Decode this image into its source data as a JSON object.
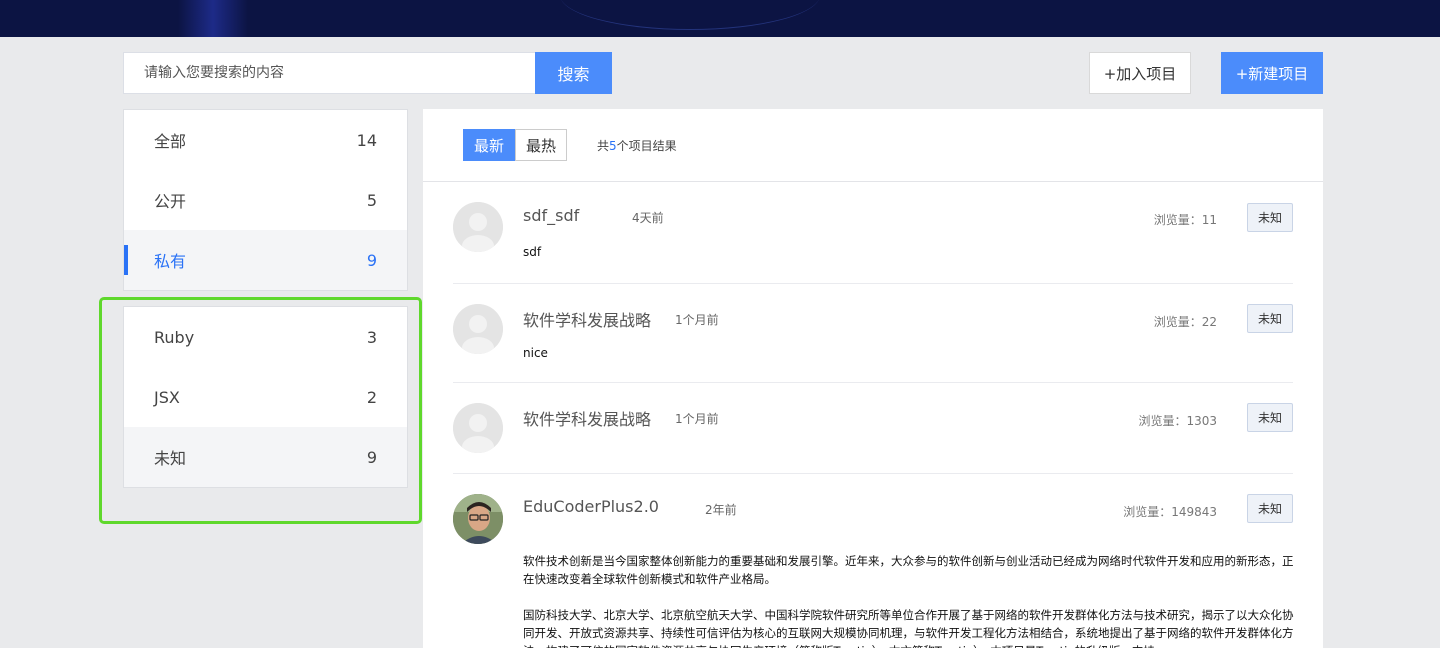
{
  "search": {
    "placeholder": "请输入您要搜索的内容",
    "button_label": "搜索"
  },
  "actions": {
    "join_label": "+加入项目",
    "new_label": "+新建项目"
  },
  "sidebar": {
    "visibility": [
      {
        "label": "全部",
        "count": "14"
      },
      {
        "label": "公开",
        "count": "5"
      },
      {
        "label": "私有",
        "count": "9"
      }
    ],
    "languages": [
      {
        "label": "Ruby",
        "count": "3"
      },
      {
        "label": "JSX",
        "count": "2"
      },
      {
        "label": "未知",
        "count": "9"
      }
    ]
  },
  "main": {
    "tabs": [
      {
        "label": "最新"
      },
      {
        "label": "最热"
      }
    ],
    "result": {
      "prefix": "共",
      "count": "5",
      "suffix": "个项目结果"
    },
    "projects": [
      {
        "title": "sdf_sdf",
        "time": "4天前",
        "views": "浏览量：11",
        "tag": "未知",
        "desc": "sdf"
      },
      {
        "title": "软件学科发展战略",
        "time": "1个月前",
        "views": "浏览量：22",
        "tag": "未知",
        "desc": "nice"
      },
      {
        "title": "软件学科发展战略",
        "time": "1个月前",
        "views": "浏览量：1303",
        "tag": "未知",
        "desc": ""
      },
      {
        "title": "EduCoderPlus2.0",
        "time": "2年前",
        "views": "浏览量：149843",
        "tag": "未知",
        "desc_paragraphs": [
          "软件技术创新是当今国家整体创新能力的重要基础和发展引擎。近年来，大众参与的软件创新与创业活动已经成为网络时代软件开发和应用的新形态，正在快速改变着全球软件创新模式和软件产业格局。",
          "国防科技大学、北京大学、北京航空航天大学、中国科学院软件研究所等单位合作开展了基于网络的软件开发群体化方法与技术研究，揭示了以大众化协同开发、开放式资源共享、持续性可信评估为核心的互联网大规模协同机理，与软件开发工程化方法相结合，系统地提出了基于网络的软件开发群体化方法，构建了可信的国家软件资源共享与协同生产环境（简称版Trustie），本文简称Trustie）。本项目是Trustie的升级版，支持"
        ]
      }
    ]
  }
}
